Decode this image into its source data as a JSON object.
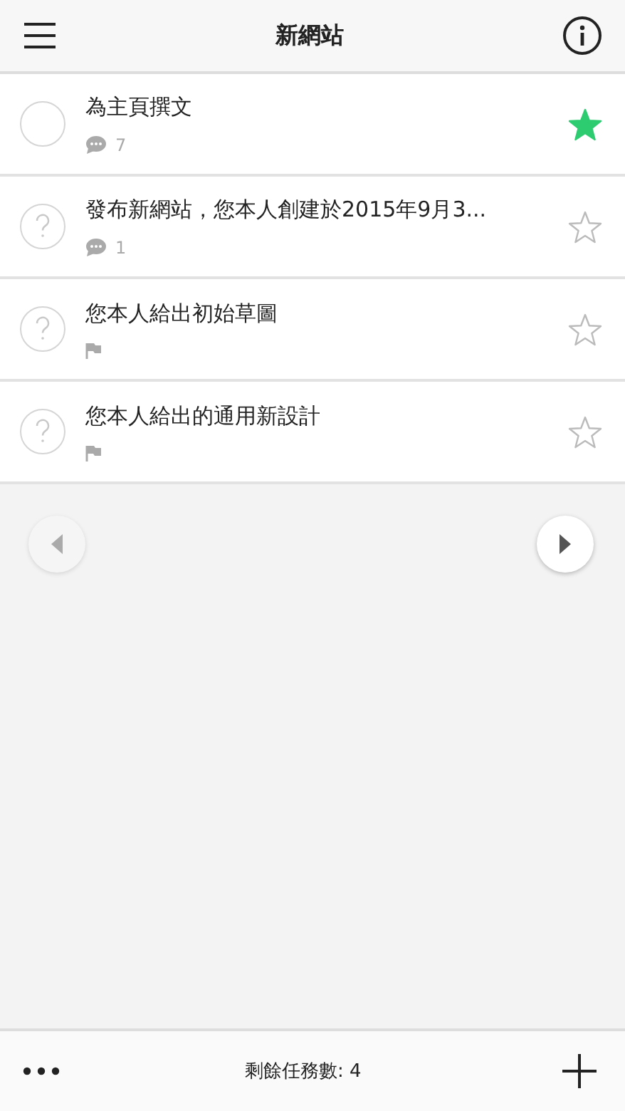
{
  "header": {
    "title": "新網站"
  },
  "tasks": [
    {
      "title": "為主頁撰文",
      "unsure": false,
      "meta": {
        "kind": "comments",
        "count": "7"
      },
      "starred": true
    },
    {
      "title": "發布新網站，您本人創建於2015年9月3...",
      "unsure": true,
      "meta": {
        "kind": "comments",
        "count": "1"
      },
      "starred": false
    },
    {
      "title": "您本人給出初始草圖",
      "unsure": true,
      "meta": {
        "kind": "flag"
      },
      "starred": false
    },
    {
      "title": "您本人給出的通用新設計",
      "unsure": true,
      "meta": {
        "kind": "flag"
      },
      "starred": false
    }
  ],
  "pager": {
    "previous_disabled": true,
    "next_disabled": false
  },
  "footer": {
    "remaining": "剩餘任務數: 4"
  }
}
